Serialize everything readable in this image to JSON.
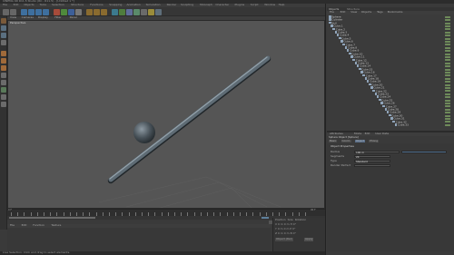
{
  "app": {
    "title": "CINEMA 4D R11.5 Studio (RC - R11.5) - [Untitled 1 *]"
  },
  "menubar": {
    "items": [
      "File",
      "Edit",
      "Objects",
      "Tools",
      "Selection",
      "Structure",
      "Functions",
      "Snapping",
      "Animation",
      "Simulation",
      "Render",
      "Sculpting",
      "MoGraph",
      "Character",
      "Plugins",
      "Script",
      "Window",
      "Help"
    ]
  },
  "toolbar": {
    "icons": [
      "undo-icon",
      "redo-icon",
      "live-select-icon",
      "move-icon",
      "scale-icon",
      "rotate-icon",
      "x-axis-icon",
      "y-axis-icon",
      "z-axis-icon",
      "world-coords-icon",
      "render-view-icon",
      "render-picture-icon",
      "render-settings-icon",
      "cube-icon",
      "spline-pen-icon",
      "subdivision-icon",
      "array-icon",
      "camera-icon",
      "light-icon",
      "scene-icon"
    ]
  },
  "viewport": {
    "menu": [
      "View",
      "Cameras",
      "Display",
      "Filter",
      "Panel"
    ],
    "label": "Perspective"
  },
  "timeline": {
    "start": "0 F",
    "end": "90 F",
    "current": "0 F"
  },
  "materials": {
    "menu": [
      "File",
      "Edit",
      "Function",
      "Texture"
    ]
  },
  "coords": {
    "header": [
      "Position",
      "Size",
      "Rotation"
    ],
    "rows": [
      {
        "axis": "X",
        "pos": "0 m",
        "size": "0 m",
        "rot": "H 0°"
      },
      {
        "axis": "Y",
        "pos": "0 m",
        "size": "0 m",
        "rot": "P 0°"
      },
      {
        "axis": "Z",
        "pos": "0 m",
        "size": "0 m",
        "rot": "B 0°"
      }
    ],
    "mode": "Object (Rel)",
    "apply": "Apply"
  },
  "status": {
    "text": "Live Selection: Click and drag to select elements."
  },
  "object_manager": {
    "tabs": [
      "Objects",
      "Structure"
    ],
    "menu": [
      "File",
      "Edit",
      "View",
      "Objects",
      "Tags",
      "Bookmarks"
    ],
    "items": [
      {
        "label": "Sphere",
        "depth": 0
      },
      {
        "label": "Cylinder",
        "depth": 0
      },
      {
        "label": "Null",
        "depth": 0
      },
      {
        "label": "Cube.1",
        "depth": 1
      },
      {
        "label": "Cube.2",
        "depth": 2
      },
      {
        "label": "Cube.3",
        "depth": 3
      },
      {
        "label": "Cube.4",
        "depth": 4
      },
      {
        "label": "Cube.5",
        "depth": 5
      },
      {
        "label": "Cube.6",
        "depth": 6
      },
      {
        "label": "Cube.7",
        "depth": 7
      },
      {
        "label": "Cube.8",
        "depth": 8
      },
      {
        "label": "Cube.9",
        "depth": 9
      },
      {
        "label": "Cube.10",
        "depth": 10
      },
      {
        "label": "Cube.11",
        "depth": 11
      },
      {
        "label": "Cube.12",
        "depth": 12
      },
      {
        "label": "Cube.13",
        "depth": 13
      },
      {
        "label": "Cube.14",
        "depth": 14
      },
      {
        "label": "Cube.15",
        "depth": 15
      },
      {
        "label": "Cube.16",
        "depth": 16
      },
      {
        "label": "Cube.17",
        "depth": 17
      },
      {
        "label": "Cube.18",
        "depth": 18
      },
      {
        "label": "Cube.19",
        "depth": 19
      },
      {
        "label": "Cube.20",
        "depth": 20
      },
      {
        "label": "Cube.21",
        "depth": 21
      },
      {
        "label": "Cube.22",
        "depth": 22
      },
      {
        "label": "Cube.23",
        "depth": 23
      },
      {
        "label": "Cube.24",
        "depth": 24
      },
      {
        "label": "Cube.25",
        "depth": 25
      },
      {
        "label": "Cube.26",
        "depth": 26
      },
      {
        "label": "Cube.27",
        "depth": 27
      },
      {
        "label": "Cube.28",
        "depth": 28
      },
      {
        "label": "Cube.29",
        "depth": 29
      },
      {
        "label": "Cube.30",
        "depth": 30
      },
      {
        "label": "Cube.31",
        "depth": 31
      },
      {
        "label": "Cube.32",
        "depth": 32
      },
      {
        "label": "Cube.33",
        "depth": 33
      }
    ]
  },
  "attributes": {
    "title": "Attributes",
    "menu": [
      "Mode",
      "Edit",
      "User Data"
    ],
    "object_label": "Sphere Object [Sphere]",
    "tabs": [
      "Basic",
      "Coord.",
      "Object",
      "Phong"
    ],
    "section": "Object Properties",
    "fields": [
      {
        "label": "Radius",
        "value": "100 m"
      },
      {
        "label": "Segments",
        "value": "24"
      },
      {
        "label": "Type",
        "value": "Standard"
      },
      {
        "label": "Render Perfect",
        "value": ""
      }
    ]
  }
}
